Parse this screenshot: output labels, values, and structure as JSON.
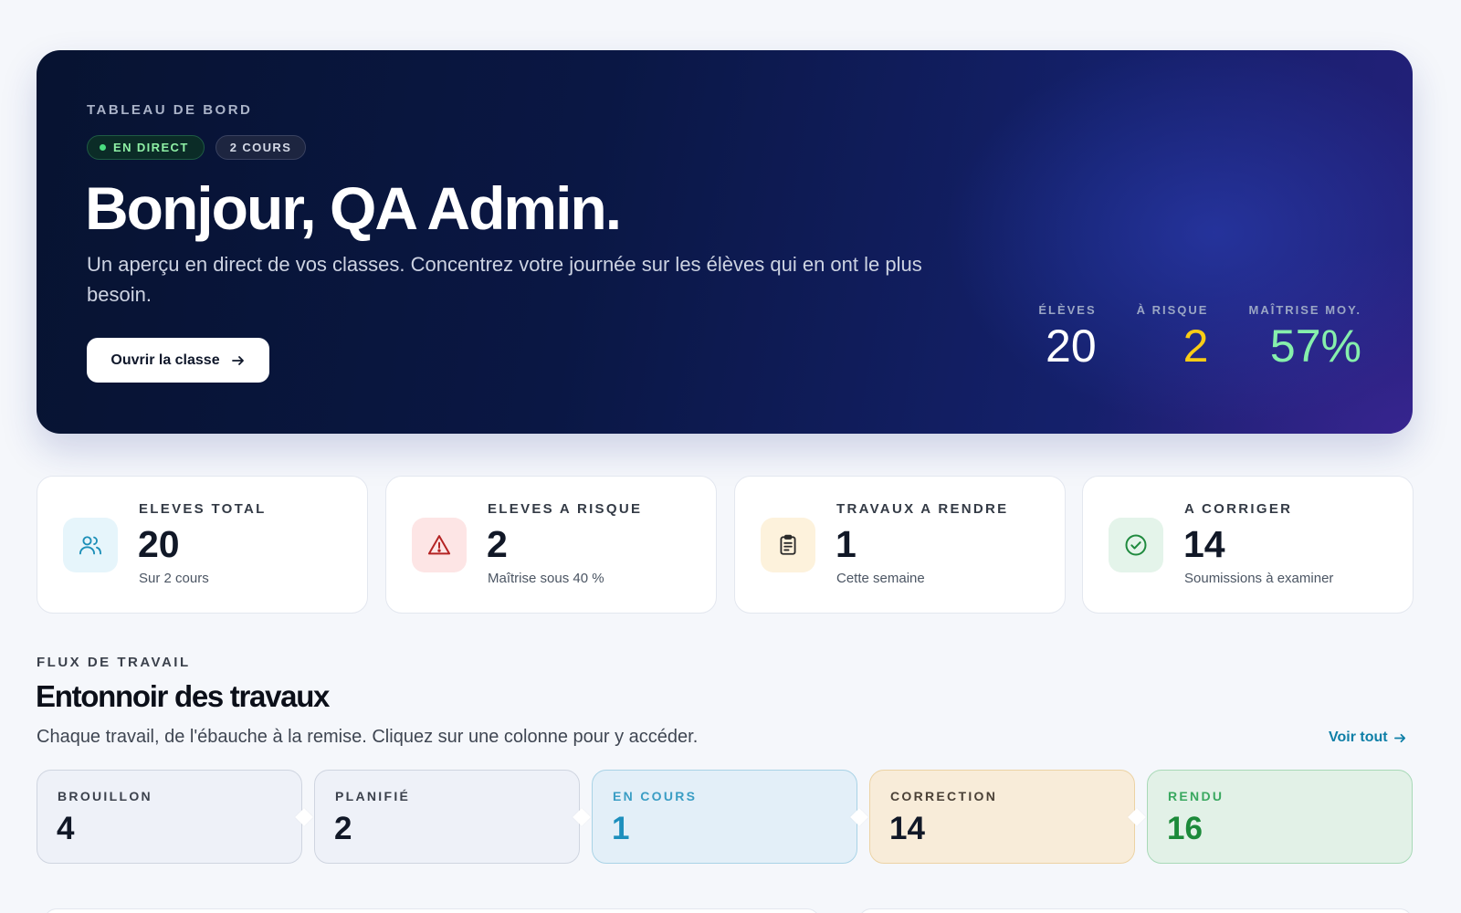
{
  "hero": {
    "eyebrow": "TABLEAU DE BORD",
    "live_badge": "EN DIRECT",
    "courses_badge": "2 COURS",
    "title": "Bonjour, QA Admin.",
    "subtitle": "Un aperçu en direct de vos classes. Concentrez votre journée sur les élèves qui en ont le plus besoin.",
    "button_label": "Ouvrir la classe",
    "stats": [
      {
        "label": "ÉLÈVES",
        "value": "20",
        "color": "#ffffff"
      },
      {
        "label": "À RISQUE",
        "value": "2",
        "color": "#facc15"
      },
      {
        "label": "MAÎTRISE MOY.",
        "value": "57%",
        "color": "#86efac"
      }
    ]
  },
  "kpis": [
    {
      "label": "ELEVES TOTAL",
      "value": "20",
      "sub": "Sur 2 cours",
      "icon": "users-icon",
      "icon_bg": "#e6f5fb",
      "icon_color": "#1c8fb8"
    },
    {
      "label": "ELEVES A RISQUE",
      "value": "2",
      "sub": "Maîtrise sous 40 %",
      "icon": "warning-icon",
      "icon_bg": "#fde5e5",
      "icon_color": "#b42323"
    },
    {
      "label": "TRAVAUX A RENDRE",
      "value": "1",
      "sub": "Cette semaine",
      "icon": "clipboard-icon",
      "icon_bg": "#fdf2dc",
      "icon_color": "#2a2a2a"
    },
    {
      "label": "A CORRIGER",
      "value": "14",
      "sub": "Soumissions à examiner",
      "icon": "check-circle-icon",
      "icon_bg": "#e4f4ea",
      "icon_color": "#1f8a3e"
    }
  ],
  "funnel": {
    "eyebrow": "FLUX DE TRAVAIL",
    "title": "Entonnoir des travaux",
    "subtitle": "Chaque travail, de l'ébauche à la remise. Cliquez sur une colonne pour y accéder.",
    "see_all": "Voir tout",
    "stages": [
      {
        "label": "BROUILLON",
        "value": "4",
        "bg": "#eef1f8",
        "border": "#cfd5e0",
        "label_color": "#3b414c",
        "value_color": "#111827"
      },
      {
        "label": "PLANIFIÉ",
        "value": "2",
        "bg": "#eef1f8",
        "border": "#cfd5e0",
        "label_color": "#3b414c",
        "value_color": "#111827"
      },
      {
        "label": "EN COURS",
        "value": "1",
        "bg": "#e3eff8",
        "border": "#a9d3e6",
        "label_color": "#3a9dc4",
        "value_color": "#1d8fbd"
      },
      {
        "label": "CORRECTION",
        "value": "14",
        "bg": "#f8ecd9",
        "border": "#ecd3a4",
        "label_color": "#4a4036",
        "value_color": "#111827"
      },
      {
        "label": "RENDU",
        "value": "16",
        "bg": "#e2f1e7",
        "border": "#a8d9b7",
        "label_color": "#3aa860",
        "value_color": "#1c8a3a"
      }
    ]
  }
}
